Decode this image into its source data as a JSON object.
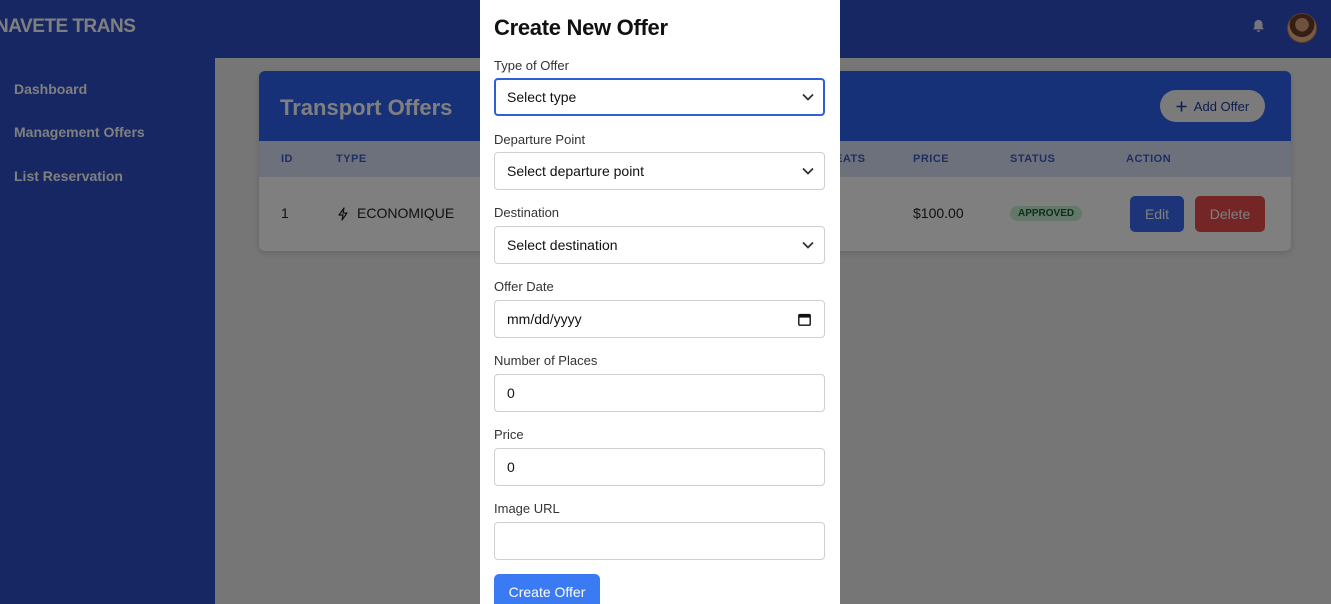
{
  "app": {
    "brand": "NAVETE TRANS"
  },
  "sidebar": {
    "items": [
      {
        "label": "Dashboard"
      },
      {
        "label": "Management Offers"
      },
      {
        "label": "List Reservation"
      }
    ]
  },
  "offers_card": {
    "title": "Transport Offers",
    "add_button": "Add Offer",
    "columns": [
      "ID",
      "TYPE",
      "EATS",
      "PRICE",
      "STATUS",
      "ACTION"
    ],
    "rows": [
      {
        "id": "1",
        "type": "ECONOMIQUE",
        "price": "$100.00",
        "status": "APPROVED",
        "edit_label": "Edit",
        "delete_label": "Delete"
      }
    ]
  },
  "modal": {
    "title": "Create New Offer",
    "fields": [
      {
        "label": "Type of Offer",
        "value": "Select type"
      },
      {
        "label": "Departure Point",
        "value": "Select departure point"
      },
      {
        "label": "Destination",
        "value": "Select destination"
      },
      {
        "label": "Offer Date",
        "value": "mm/dd/yyyy"
      },
      {
        "label": "Number of Places",
        "value": "0"
      },
      {
        "label": "Price",
        "value": "0"
      },
      {
        "label": "Image URL",
        "value": ""
      }
    ],
    "submit_label": "Create Offer"
  },
  "icons": {
    "notifications": "bell-icon",
    "user": "avatar",
    "add": "plus-icon",
    "type": "bolt-icon",
    "select": "chevron-down-icon",
    "date": "calendar-icon"
  },
  "colors": {
    "primary": "#2d4fc7",
    "header": "#2f63f0",
    "edit": "#3a6af0",
    "delete": "#e84d4d",
    "approved_bg": "#c9f0d3",
    "submit": "#3a7af2"
  }
}
